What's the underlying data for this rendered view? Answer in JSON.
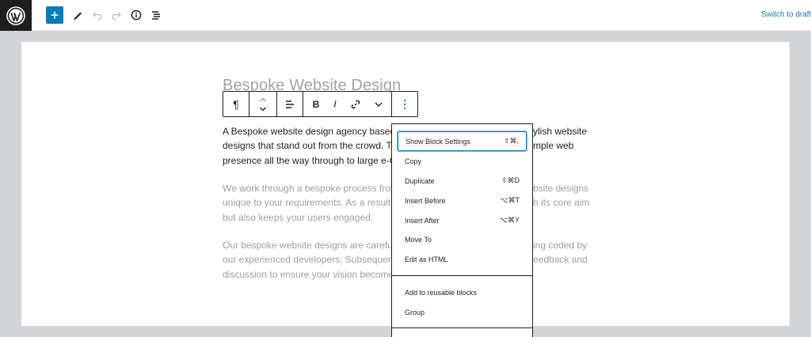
{
  "topbar": {
    "logo_icon": "wordpress-logo",
    "tools": [
      {
        "name": "add-block-button",
        "icon": "plus-icon"
      },
      {
        "name": "tools-button",
        "icon": "pencil-icon"
      },
      {
        "name": "undo-button",
        "icon": "undo-icon"
      },
      {
        "name": "redo-button",
        "icon": "redo-icon"
      },
      {
        "name": "details-button",
        "icon": "info-icon"
      },
      {
        "name": "outline-button",
        "icon": "list-view-icon"
      }
    ],
    "switch_to_draft": "Switch to draft"
  },
  "editor": {
    "title": "Bespoke Website Design",
    "paragraphs": [
      {
        "lines": [
          "A Bespoke website design agency based i",
          "designs that stand out from the crowd. Th",
          "presence all the way through to large e-Co"
        ],
        "right_lines": [
          "ylish website",
          "mple web",
          ""
        ]
      },
      {
        "lines": [
          "We work through a bespoke process from",
          "unique to your requirements. As a result, n",
          "but also keeps your users engaged."
        ],
        "right_lines": [
          "bsite designs",
          "h its core aim",
          ""
        ]
      },
      {
        "lines": [
          "Our bespoke website designs are carefully",
          "our experienced developers. Subsequently",
          "discussion to ensure your vision becomes"
        ],
        "right_lines": [
          "ing coded by",
          "eedback and",
          ""
        ]
      }
    ]
  },
  "block_toolbar": {
    "paragraph_icon": "pilcrow-icon",
    "move_icon": "move-up-down-icon",
    "align_icon": "align-left-icon",
    "bold_label": "B",
    "italic_label": "I",
    "link_icon": "link-icon",
    "more_rich_text_icon": "chevron-down-icon",
    "more_options_icon": "more-vertical-icon"
  },
  "more_menu": {
    "items": [
      {
        "label": "Show Block Settings",
        "shortcut": "⇧⌘,",
        "focused": true
      },
      {
        "label": "Copy",
        "shortcut": ""
      },
      {
        "label": "Duplicate",
        "shortcut": "⇧⌘D"
      },
      {
        "label": "Insert Before",
        "shortcut": "⌥⌘T"
      },
      {
        "label": "Insert After",
        "shortcut": "⌥⌘Y"
      },
      {
        "label": "Move To",
        "shortcut": ""
      },
      {
        "label": "Edit as HTML",
        "shortcut": ""
      }
    ],
    "group2": [
      {
        "label": "Add to reusable blocks",
        "shortcut": ""
      },
      {
        "label": "Group",
        "shortcut": ""
      }
    ]
  },
  "colors": {
    "accent": "#007cba",
    "topbar_logo_bg": "#1e1e1e",
    "editor_bg": "#d2d4d7",
    "title_placeholder": "#a0a4a8",
    "link": "#1e73be"
  }
}
